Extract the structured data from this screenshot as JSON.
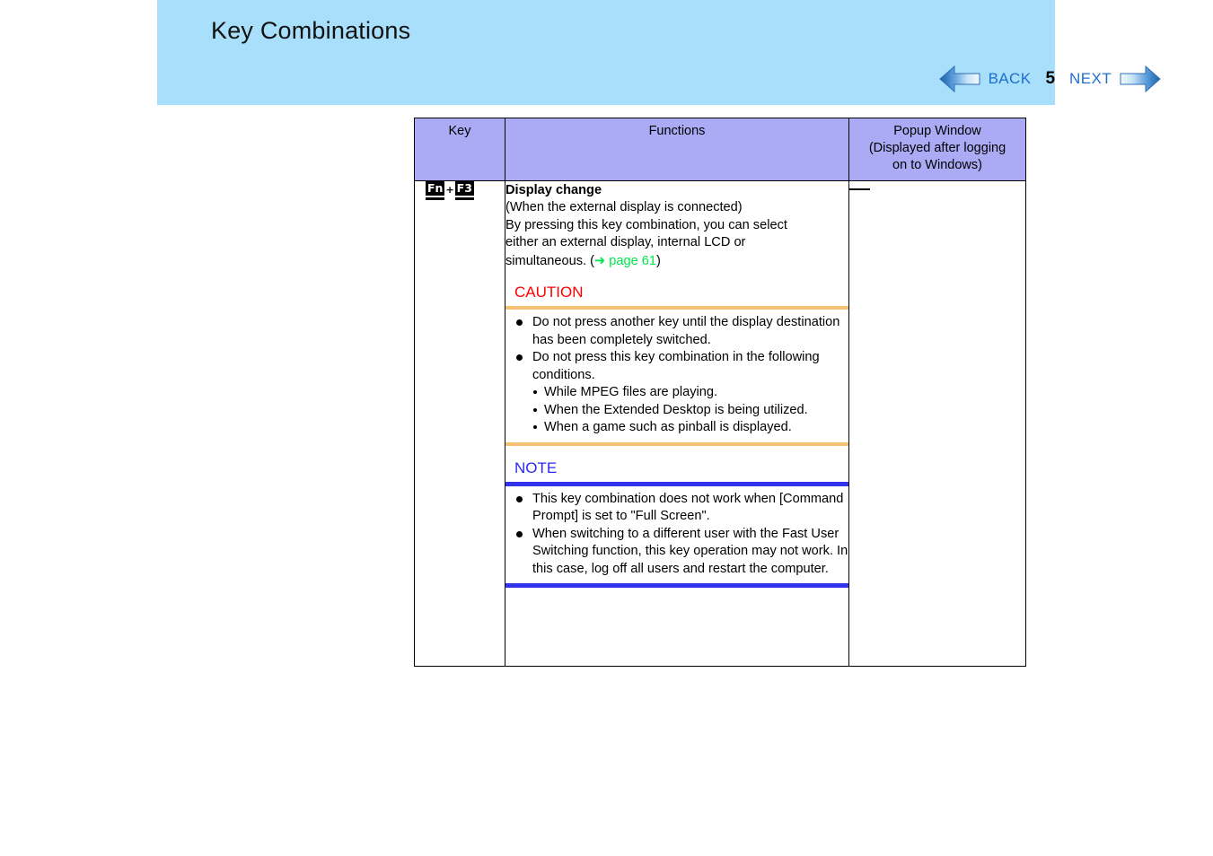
{
  "header": {
    "title": "Key Combinations",
    "banner_color": "#a8dffa"
  },
  "nav": {
    "back_label": "BACK",
    "page_number": "5",
    "next_label": "NEXT",
    "back_icon": "left-arrow-icon",
    "next_icon": "right-arrow-icon",
    "link_color": "#1f6fd0"
  },
  "table": {
    "header_bg": "#aaaaf5",
    "columns": [
      {
        "label": "Key"
      },
      {
        "label": "Functions"
      },
      {
        "label": "Popup Window\n(Displayed after logging\non to Windows)",
        "line1": "Popup Window",
        "line2": "(Displayed after logging",
        "line3": "on to Windows)"
      }
    ],
    "rows": [
      {
        "key": {
          "modifier": "Fn",
          "plus": "+",
          "key": "F3"
        },
        "functions": {
          "title": "Display change",
          "paragraphs": [
            "(When the external display is connected)",
            "By pressing this key combination, you can select",
            "either an external display, internal LCD or"
          ],
          "last_line_prefix": "simultaneous.  (",
          "link_arrow": "➜",
          "link_text": "page 61",
          "link_color": "#00e64a",
          "last_line_suffix": ")",
          "callouts": [
            {
              "kind": "caution",
              "title": "CAUTION",
              "title_color": "#ff0000",
              "rule_color": "#f8bf76",
              "bullets": [
                {
                  "text": "Do not press another key until the display destination has been completely switched."
                },
                {
                  "text": "Do not press this key combination in the following conditions.",
                  "subbullets": [
                    "While MPEG files are playing.",
                    "When the Extended Desktop is being utilized.",
                    "When a game such as pinball is displayed."
                  ]
                }
              ]
            },
            {
              "kind": "note",
              "title": "NOTE",
              "title_color": "#2a2aee",
              "rule_color": "#3333ee",
              "bullets": [
                {
                  "text": "This key combination does not work when [Command Prompt] is set to \"Full Screen\"."
                },
                {
                  "text": "When switching to a different user with the Fast User Switching function, this key operation may not work. In this case, log off all users and restart the computer."
                }
              ]
            }
          ]
        },
        "popup": {
          "value": "—"
        }
      }
    ]
  }
}
